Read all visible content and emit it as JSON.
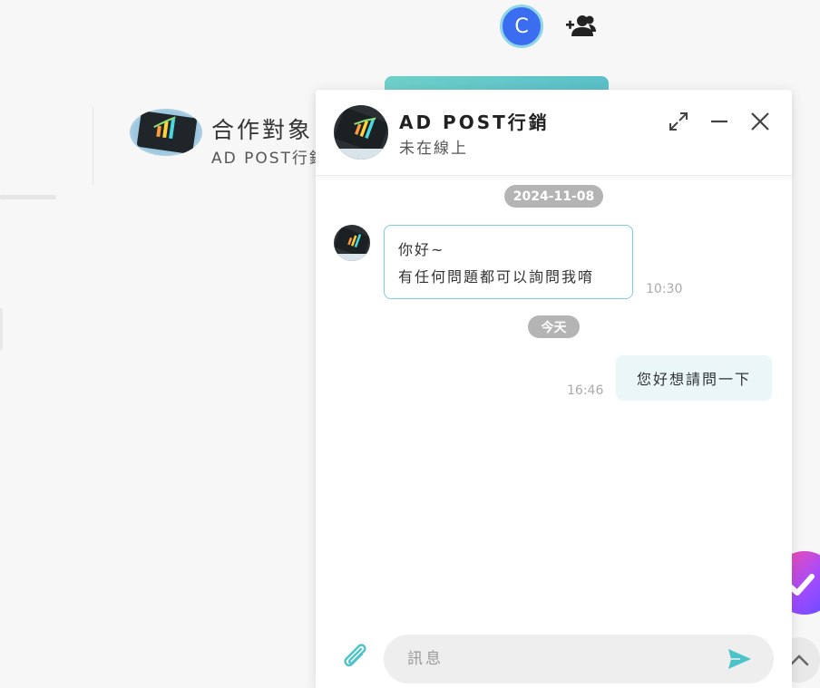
{
  "top": {
    "user_initial": "C",
    "user_avatar_color": "#3a6df0",
    "add_friend_icon": "user-plus-icon"
  },
  "partner": {
    "title": "合作對象",
    "subtitle": "AD POST行銷"
  },
  "chat": {
    "name": "AD POST行銷",
    "status": "未在線上",
    "header_icons": [
      "expand-icon",
      "minimize-icon",
      "close-icon"
    ],
    "groups": [
      {
        "date": "2024-11-08",
        "messages": [
          {
            "direction": "in",
            "lines": [
              "你好~",
              "有任何問題都可以詢問我唷"
            ],
            "time": "10:30"
          }
        ]
      },
      {
        "date": "今天",
        "messages": [
          {
            "direction": "out",
            "lines": [
              "您好想請問一下"
            ],
            "time": "16:46"
          }
        ]
      }
    ],
    "input": {
      "placeholder": "訊息",
      "value": ""
    },
    "colors": {
      "accent": "#4cc3c8",
      "incoming_border": "#78d0d4",
      "outgoing_bg": "#eaf6f8"
    }
  }
}
